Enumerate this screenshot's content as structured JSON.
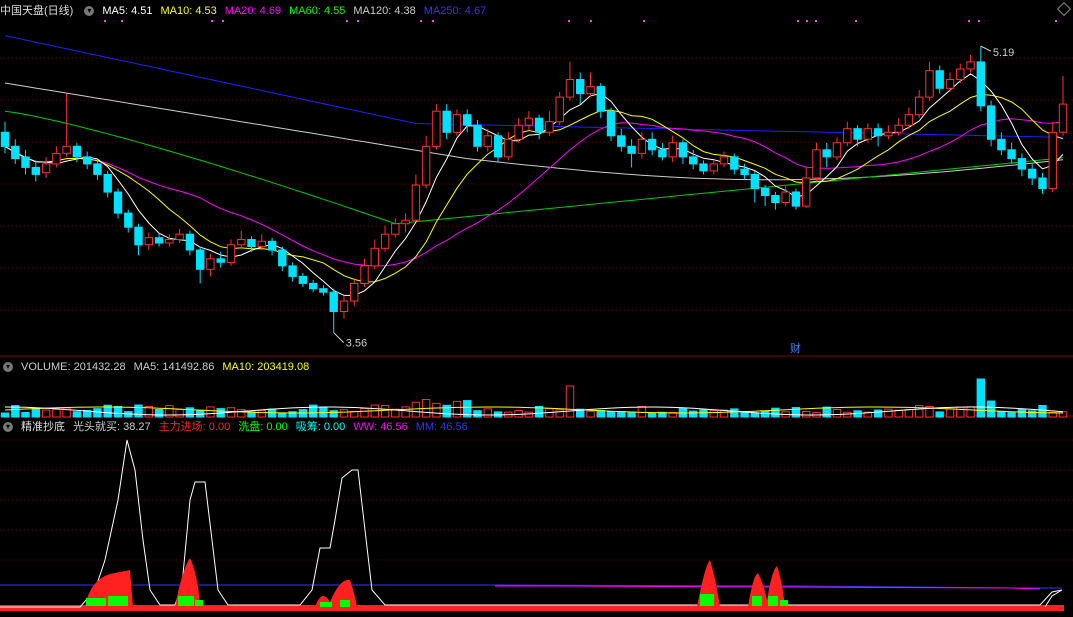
{
  "chart_data": [
    {
      "type": "candlestick",
      "title": "中国天盘(日线)",
      "indicators": [
        {
          "name": "MA5",
          "value": "4.51",
          "color": "#ffffff"
        },
        {
          "name": "MA10",
          "value": "4.53",
          "color": "#ffff00"
        },
        {
          "name": "MA20",
          "value": "4.69",
          "color": "#ff00ff"
        },
        {
          "name": "MA60",
          "value": "4.55",
          "color": "#00ff00"
        },
        {
          "name": "MA120",
          "value": "4.38",
          "color": "#cccccc"
        },
        {
          "name": "MA250",
          "value": "4.67",
          "color": "#3333ff"
        }
      ],
      "high_label": "5.19",
      "low_label": "3.56",
      "event_marker": "财",
      "ylim": [
        3.45,
        5.35
      ],
      "candles": [
        [
          4.7,
          4.62,
          4.76,
          4.58
        ],
        [
          4.62,
          4.55,
          4.66,
          4.52
        ],
        [
          4.56,
          4.5,
          4.6,
          4.46
        ],
        [
          4.5,
          4.46,
          4.54,
          4.42
        ],
        [
          4.47,
          4.52,
          4.56,
          4.44
        ],
        [
          4.52,
          4.58,
          4.62,
          4.5
        ],
        [
          4.58,
          4.62,
          4.92,
          4.56
        ],
        [
          4.62,
          4.56,
          4.64,
          4.53
        ],
        [
          4.56,
          4.52,
          4.59,
          4.49
        ],
        [
          4.52,
          4.46,
          4.54,
          4.43
        ],
        [
          4.46,
          4.36,
          4.48,
          4.33
        ],
        [
          4.36,
          4.24,
          4.38,
          4.21
        ],
        [
          4.24,
          4.16,
          4.26,
          4.13
        ],
        [
          4.16,
          4.06,
          4.18,
          4.0
        ],
        [
          4.06,
          4.1,
          4.13,
          4.03
        ],
        [
          4.1,
          4.07,
          4.13,
          4.05
        ],
        [
          4.07,
          4.09,
          4.12,
          4.05
        ],
        [
          4.09,
          4.12,
          4.15,
          4.07
        ],
        [
          4.12,
          4.03,
          4.14,
          4.0
        ],
        [
          4.03,
          3.92,
          4.05,
          3.84
        ],
        [
          3.92,
          3.98,
          4.01,
          3.88
        ],
        [
          3.98,
          3.96,
          4.02,
          3.93
        ],
        [
          3.96,
          4.06,
          4.09,
          3.94
        ],
        [
          4.06,
          4.09,
          4.14,
          4.04
        ],
        [
          4.09,
          4.05,
          4.11,
          4.02
        ],
        [
          4.05,
          4.08,
          4.12,
          4.03
        ],
        [
          4.08,
          4.03,
          4.1,
          4.0
        ],
        [
          4.03,
          3.94,
          4.05,
          3.91
        ],
        [
          3.94,
          3.88,
          3.96,
          3.85
        ],
        [
          3.88,
          3.84,
          3.9,
          3.82
        ],
        [
          3.84,
          3.81,
          3.86,
          3.79
        ],
        [
          3.81,
          3.79,
          3.83,
          3.77
        ],
        [
          3.79,
          3.68,
          3.81,
          3.56
        ],
        [
          3.68,
          3.74,
          3.77,
          3.64
        ],
        [
          3.74,
          3.84,
          3.87,
          3.71
        ],
        [
          3.84,
          3.94,
          3.98,
          3.82
        ],
        [
          3.94,
          4.04,
          4.09,
          3.92
        ],
        [
          4.04,
          4.12,
          4.17,
          4.02
        ],
        [
          4.12,
          4.18,
          4.21,
          4.1
        ],
        [
          4.18,
          4.2,
          4.24,
          4.13
        ],
        [
          4.2,
          4.4,
          4.46,
          4.19
        ],
        [
          4.4,
          4.62,
          4.68,
          4.38
        ],
        [
          4.62,
          4.82,
          4.86,
          4.6
        ],
        [
          4.82,
          4.7,
          4.86,
          4.66
        ],
        [
          4.7,
          4.8,
          4.83,
          4.68
        ],
        [
          4.8,
          4.74,
          4.83,
          4.7
        ],
        [
          4.74,
          4.62,
          4.77,
          4.59
        ],
        [
          4.62,
          4.68,
          4.72,
          4.59
        ],
        [
          4.68,
          4.56,
          4.7,
          4.53
        ],
        [
          4.56,
          4.66,
          4.7,
          4.54
        ],
        [
          4.66,
          4.74,
          4.78,
          4.64
        ],
        [
          4.74,
          4.78,
          4.82,
          4.71
        ],
        [
          4.78,
          4.7,
          4.8,
          4.66
        ],
        [
          4.7,
          4.76,
          4.82,
          4.68
        ],
        [
          4.76,
          4.9,
          4.93,
          4.74
        ],
        [
          4.9,
          5.0,
          5.1,
          4.88
        ],
        [
          5.0,
          4.92,
          5.04,
          4.86
        ],
        [
          4.92,
          4.96,
          5.04,
          4.9
        ],
        [
          4.96,
          4.82,
          4.98,
          4.78
        ],
        [
          4.82,
          4.68,
          4.84,
          4.65
        ],
        [
          4.68,
          4.62,
          4.72,
          4.59
        ],
        [
          4.62,
          4.58,
          4.66,
          4.5
        ],
        [
          4.58,
          4.66,
          4.7,
          4.55
        ],
        [
          4.66,
          4.6,
          4.7,
          4.57
        ],
        [
          4.6,
          4.56,
          4.64,
          4.54
        ],
        [
          4.56,
          4.64,
          4.68,
          4.53
        ],
        [
          4.64,
          4.56,
          4.66,
          4.52
        ],
        [
          4.56,
          4.52,
          4.6,
          4.49
        ],
        [
          4.52,
          4.48,
          4.54,
          4.46
        ],
        [
          4.48,
          4.52,
          4.54,
          4.46
        ],
        [
          4.52,
          4.56,
          4.59,
          4.5
        ],
        [
          4.56,
          4.49,
          4.58,
          4.46
        ],
        [
          4.49,
          4.46,
          4.52,
          4.43
        ],
        [
          4.46,
          4.38,
          4.48,
          4.3
        ],
        [
          4.38,
          4.34,
          4.4,
          4.28
        ],
        [
          4.34,
          4.3,
          4.36,
          4.26
        ],
        [
          4.3,
          4.36,
          4.4,
          4.28
        ],
        [
          4.36,
          4.28,
          4.38,
          4.26
        ],
        [
          4.28,
          4.44,
          4.5,
          4.27
        ],
        [
          4.44,
          4.6,
          4.64,
          4.42
        ],
        [
          4.6,
          4.56,
          4.64,
          4.5
        ],
        [
          4.56,
          4.64,
          4.67,
          4.54
        ],
        [
          4.64,
          4.72,
          4.76,
          4.62
        ],
        [
          4.72,
          4.66,
          4.74,
          4.62
        ],
        [
          4.66,
          4.72,
          4.75,
          4.64
        ],
        [
          4.72,
          4.68,
          4.75,
          4.62
        ],
        [
          4.68,
          4.7,
          4.74,
          4.66
        ],
        [
          4.7,
          4.74,
          4.78,
          4.68
        ],
        [
          4.74,
          4.8,
          4.84,
          4.72
        ],
        [
          4.8,
          4.9,
          4.94,
          4.78
        ],
        [
          4.9,
          5.05,
          5.1,
          4.88
        ],
        [
          5.05,
          4.95,
          5.08,
          4.92
        ],
        [
          4.95,
          5.0,
          5.04,
          4.93
        ],
        [
          5.0,
          5.06,
          5.09,
          4.98
        ],
        [
          5.06,
          5.1,
          5.14,
          5.04
        ],
        [
          5.1,
          4.85,
          5.19,
          4.82
        ],
        [
          4.85,
          4.66,
          4.88,
          4.62
        ],
        [
          4.66,
          4.6,
          4.7,
          4.57
        ],
        [
          4.6,
          4.55,
          4.64,
          4.52
        ],
        [
          4.55,
          4.49,
          4.58,
          4.45
        ],
        [
          4.49,
          4.44,
          4.52,
          4.4
        ],
        [
          4.44,
          4.38,
          4.47,
          4.35
        ],
        [
          4.38,
          4.7,
          4.76,
          4.36
        ],
        [
          4.7,
          4.86,
          5.02,
          4.68
        ]
      ]
    },
    {
      "type": "bar",
      "title": "VOLUME",
      "indicators": [
        {
          "name": "VOLUME",
          "value": "201432.28",
          "color": "#cccccc"
        },
        {
          "name": "MA5",
          "value": "141492.86",
          "color": "#cccccc"
        },
        {
          "name": "MA10",
          "value": "203419.08",
          "color": "#ffff00"
        }
      ]
    },
    {
      "type": "line",
      "title": "精准抄底",
      "indicators": [
        {
          "name": "光头就买",
          "value": "38.27",
          "color": "#cccccc"
        },
        {
          "name": "主力进场",
          "value": "0.00",
          "color": "#ff2020"
        },
        {
          "name": "洗盘",
          "value": "0.00",
          "color": "#00ff00"
        },
        {
          "name": "吸筹",
          "value": "0.00",
          "color": "#00ffff"
        },
        {
          "name": "WW",
          "value": "46.56",
          "color": "#ff00ff"
        },
        {
          "name": "MM",
          "value": "46.56",
          "color": "#3333ff"
        }
      ]
    }
  ]
}
